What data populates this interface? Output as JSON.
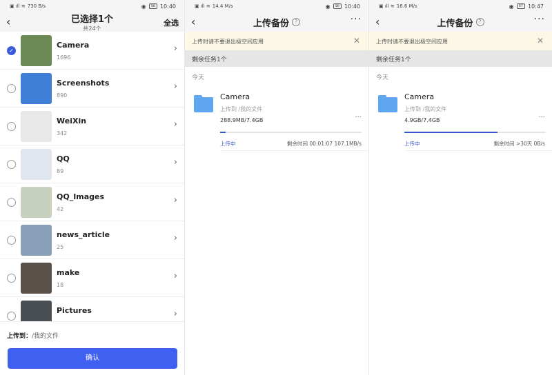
{
  "screens": [
    {
      "status": {
        "net": "730 B/s",
        "time": "10:40",
        "battery": "98"
      },
      "header": {
        "title": "已选择1个",
        "subtitle": "共24个",
        "select_all": "全选"
      },
      "folders": [
        {
          "name": "Camera",
          "count": "1696",
          "selected": true,
          "thumb": "#6b8a55"
        },
        {
          "name": "Screenshots",
          "count": "890",
          "selected": false,
          "thumb": "#3f7fd8"
        },
        {
          "name": "WeiXin",
          "count": "342",
          "selected": false,
          "thumb": "#e8e8e8"
        },
        {
          "name": "QQ",
          "count": "89",
          "selected": false,
          "thumb": "#dfe6ef"
        },
        {
          "name": "QQ_Images",
          "count": "42",
          "selected": false,
          "thumb": "#c8d0c0"
        },
        {
          "name": "news_article",
          "count": "25",
          "selected": false,
          "thumb": "#8aa0b8"
        },
        {
          "name": "make",
          "count": "18",
          "selected": false,
          "thumb": "#5a5048"
        },
        {
          "name": "Pictures",
          "count": "",
          "selected": false,
          "thumb": "#4a4e55"
        }
      ],
      "footer": {
        "label": "上传到：",
        "path": "/我的文件",
        "confirm": "确认"
      }
    },
    {
      "status": {
        "net": "14.4 M/s",
        "time": "10:40",
        "battery": "98"
      },
      "header": {
        "title": "上传备份",
        "help": "?",
        "more": "···"
      },
      "banner": "上传时请不要退出极空间应用",
      "close": "✕",
      "remaining": "剩余任务1个",
      "today": "今天",
      "task": {
        "name": "Camera",
        "dest": "上传到   /我的文件",
        "size": "288.9MB/7.4GB",
        "progress": 0.04,
        "state": "上传中",
        "eta": "剩余时间 00:01:07 107.1MB/s",
        "more": "···"
      }
    },
    {
      "status": {
        "net": "16.6 M/s",
        "time": "10:47",
        "battery": "97"
      },
      "header": {
        "title": "上传备份",
        "help": "?",
        "more": "···"
      },
      "banner": "上传时请不要退出极空间应用",
      "close": "✕",
      "remaining": "剩余任务1个",
      "today": "今天",
      "task": {
        "name": "Camera",
        "dest": "上传到   /我的文件",
        "size": "4.9GB/7.4GB",
        "progress": 0.66,
        "state": "上传中",
        "eta": "剩余时间 >30天 0B/s",
        "more": "···"
      }
    }
  ]
}
